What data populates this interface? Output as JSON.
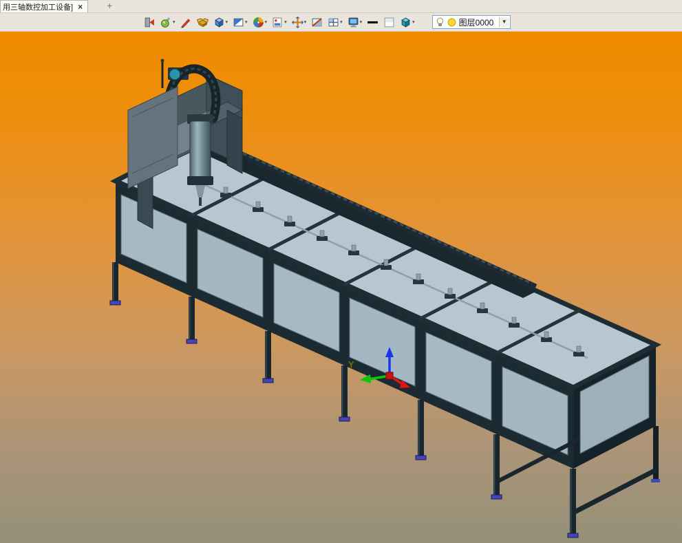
{
  "tab_bar": {
    "active_tab": {
      "title": "用三轴数控加工设备]",
      "close_glyph": "×"
    },
    "new_tab_glyph": "+"
  },
  "toolbar": {
    "caret_glyph": "▾",
    "icons": [
      {
        "name": "exit-viewer",
        "has_dropdown": false
      },
      {
        "name": "appearance-color",
        "has_dropdown": true
      },
      {
        "name": "annotation-pencil",
        "has_dropdown": false
      },
      {
        "name": "explode-box",
        "has_dropdown": false
      },
      {
        "name": "view-cube",
        "has_dropdown": true
      },
      {
        "name": "render-style",
        "has_dropdown": true
      },
      {
        "name": "color-wheel",
        "has_dropdown": true
      },
      {
        "name": "snapshot-image",
        "has_dropdown": true
      },
      {
        "name": "move-arrows",
        "has_dropdown": true
      },
      {
        "name": "section-view",
        "has_dropdown": false
      },
      {
        "name": "viewport-layout",
        "has_dropdown": true
      },
      {
        "name": "display-mode",
        "has_dropdown": true
      },
      {
        "name": "line-width",
        "has_dropdown": false
      },
      {
        "name": "background-color",
        "has_dropdown": false
      },
      {
        "name": "shaded-cube",
        "has_dropdown": true
      }
    ],
    "layer_selector": {
      "value": "图层0000",
      "caret_glyph": "▼"
    }
  },
  "viewport": {
    "background_top": "#F08B00",
    "background_bottom": "#949078",
    "triad": {
      "y_label": "Y"
    }
  }
}
